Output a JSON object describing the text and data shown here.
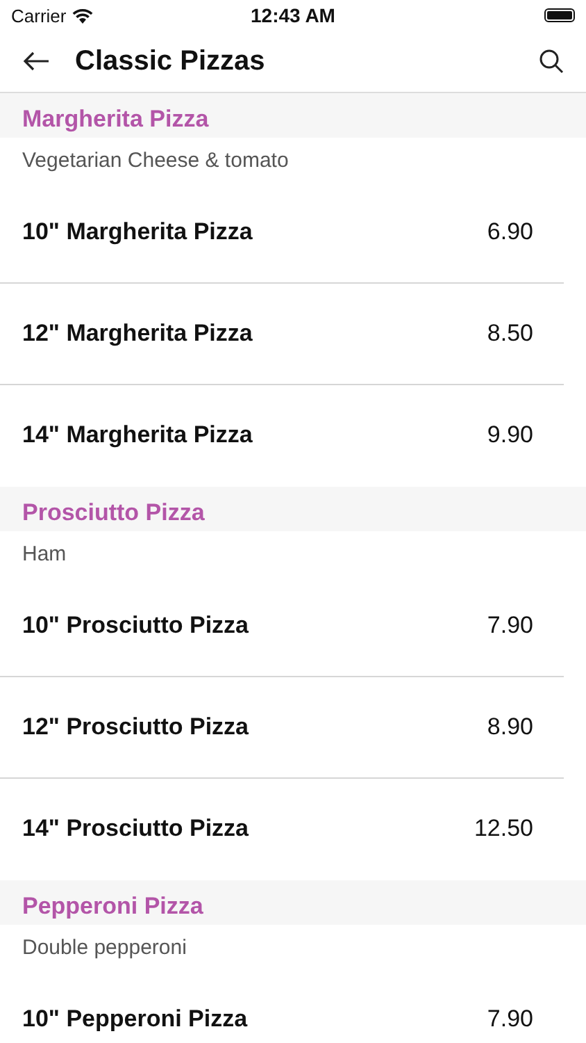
{
  "status_bar": {
    "carrier": "Carrier",
    "time": "12:43 AM"
  },
  "header": {
    "title": "Classic Pizzas"
  },
  "sections": [
    {
      "title": "Margherita Pizza",
      "description": "Vegetarian Cheese & tomato",
      "items": [
        {
          "name": "10\" Margherita Pizza",
          "price": "6.90"
        },
        {
          "name": "12\" Margherita Pizza",
          "price": "8.50"
        },
        {
          "name": "14\" Margherita Pizza",
          "price": "9.90"
        }
      ]
    },
    {
      "title": "Prosciutto Pizza",
      "description": "Ham",
      "items": [
        {
          "name": "10\" Prosciutto Pizza",
          "price": "7.90"
        },
        {
          "name": "12\" Prosciutto Pizza",
          "price": "8.90"
        },
        {
          "name": "14\" Prosciutto Pizza",
          "price": "12.50"
        }
      ]
    },
    {
      "title": "Pepperoni Pizza",
      "description": "Double pepperoni",
      "items": [
        {
          "name": "10\" Pepperoni Pizza",
          "price": "7.90"
        }
      ]
    }
  ]
}
